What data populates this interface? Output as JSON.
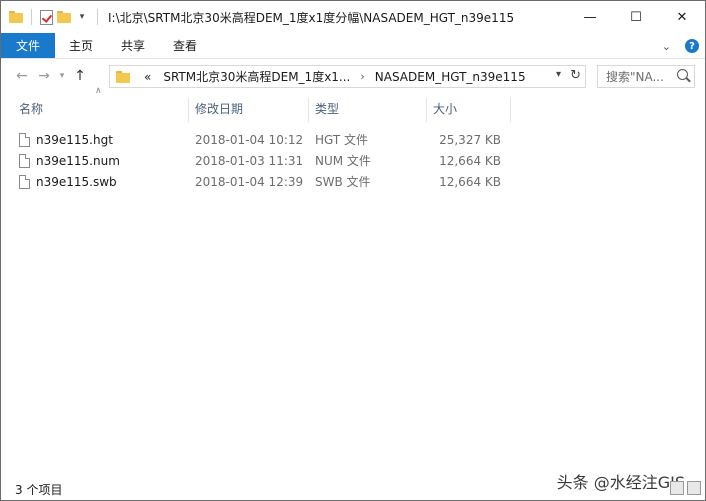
{
  "title_bar": {
    "path": "I:\\北京\\SRTM北京30米高程DEM_1度x1度分幅\\NASADEM_HGT_n39e115",
    "minimize": "—",
    "maximize": "☐",
    "close": "✕"
  },
  "ribbon": {
    "tabs": [
      "文件",
      "主页",
      "共享",
      "查看"
    ],
    "expand_icon": "chevron-down-icon",
    "help": "?"
  },
  "nav": {
    "back": "←",
    "forward": "→",
    "recent": "▾",
    "up": "↑"
  },
  "address": {
    "overflow": "«",
    "crumbs": [
      "SRTM北京30米高程DEM_1度x1...",
      "NASADEM_HGT_n39e115"
    ],
    "separator": "›",
    "dropdown": "▾",
    "refresh": "↻"
  },
  "search": {
    "placeholder": "搜索\"NA..."
  },
  "columns": [
    "名称",
    "修改日期",
    "类型",
    "大小"
  ],
  "files": [
    {
      "name": "n39e115.hgt",
      "modified": "2018-01-04 10:12",
      "type": "HGT 文件",
      "size": "25,327 KB"
    },
    {
      "name": "n39e115.num",
      "modified": "2018-01-03 11:31",
      "type": "NUM 文件",
      "size": "12,664 KB"
    },
    {
      "name": "n39e115.swb",
      "modified": "2018-01-04 12:39",
      "type": "SWB 文件",
      "size": "12,664 KB"
    }
  ],
  "status": {
    "count": "3 个项目"
  },
  "watermark": "头条 @水经注GIS"
}
